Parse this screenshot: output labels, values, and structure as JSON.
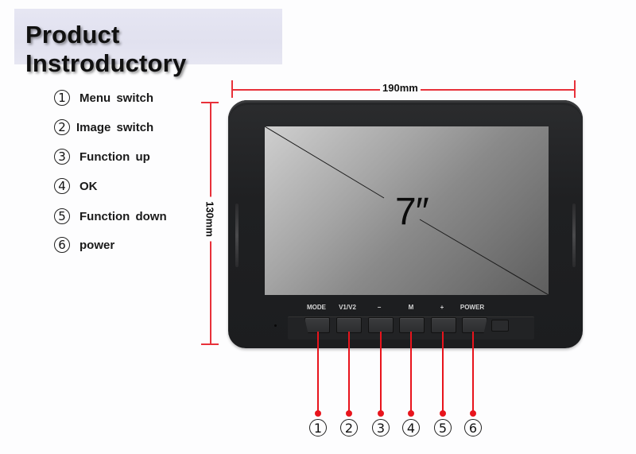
{
  "title": "Product Instroductory",
  "legend": [
    {
      "num": "1",
      "label": "Menu switch"
    },
    {
      "num": "2",
      "label": "Image switch"
    },
    {
      "num": "3",
      "label": "Function up"
    },
    {
      "num": "4",
      "label": "OK"
    },
    {
      "num": "5",
      "label": "Function down"
    },
    {
      "num": "6",
      "label": "power"
    }
  ],
  "dimensions": {
    "width": "190mm",
    "height": "130mm"
  },
  "screen": {
    "size_label": "7″"
  },
  "buttons": [
    {
      "label": "MODE",
      "num": "1"
    },
    {
      "label": "V1/V2",
      "num": "2"
    },
    {
      "label": "−",
      "num": "3"
    },
    {
      "label": "M",
      "num": "4"
    },
    {
      "label": "+",
      "num": "5"
    },
    {
      "label": "POWER",
      "num": "6"
    }
  ],
  "colors": {
    "dimension_line": "#e8313a",
    "callout": "#e8141c",
    "title_bg": "#e3e3f0"
  }
}
